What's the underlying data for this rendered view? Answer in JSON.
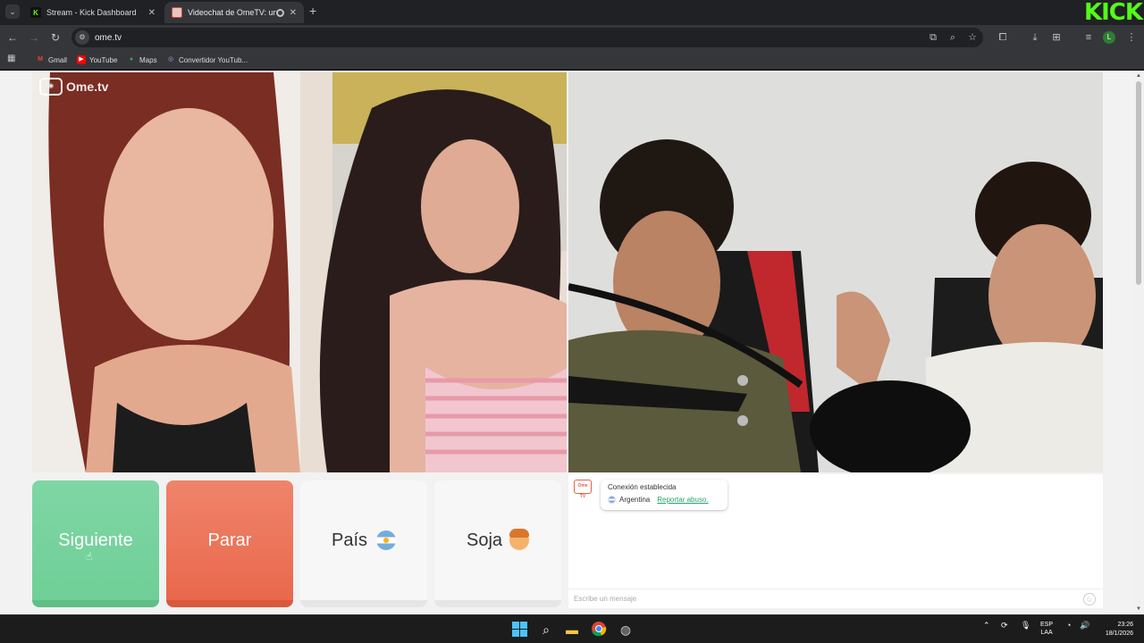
{
  "browser": {
    "tabs": [
      {
        "title": "Stream - Kick Dashboard",
        "active": false,
        "favicon": "kick-icon"
      },
      {
        "title": "Videochat de OmeTV: una",
        "active": true,
        "favicon": "ometv-icon"
      }
    ],
    "new_tab": "+",
    "url": "ome.tv",
    "kick_logo": "KICK",
    "profile_initial": "L",
    "bookmarks": [
      {
        "label": "Gmail",
        "icon": "gmail-icon"
      },
      {
        "label": "YouTube",
        "icon": "youtube-icon"
      },
      {
        "label": "Maps",
        "icon": "maps-icon"
      },
      {
        "label": "Convertidor YouTub...",
        "icon": "converter-icon"
      }
    ]
  },
  "page": {
    "watermark": "Ome.tv",
    "buttons": {
      "next": "Siguiente",
      "stop": "Parar",
      "country": "País",
      "gender": "Soja"
    },
    "chat": {
      "avatar_text": "Ome TV",
      "status": "Conexión establecida",
      "country": "Argentina",
      "report": "Reportar abuso.",
      "input_placeholder": "Escribe un mensaje"
    }
  },
  "taskbar": {
    "language_top": "ESP",
    "language_bottom": "LAA",
    "time": "23:26",
    "date": "18/1/2026"
  },
  "colors": {
    "next_button": "#6fcf97",
    "stop_button": "#e9684c",
    "kick_green": "#53fc18",
    "report_link": "#2aa36a"
  }
}
